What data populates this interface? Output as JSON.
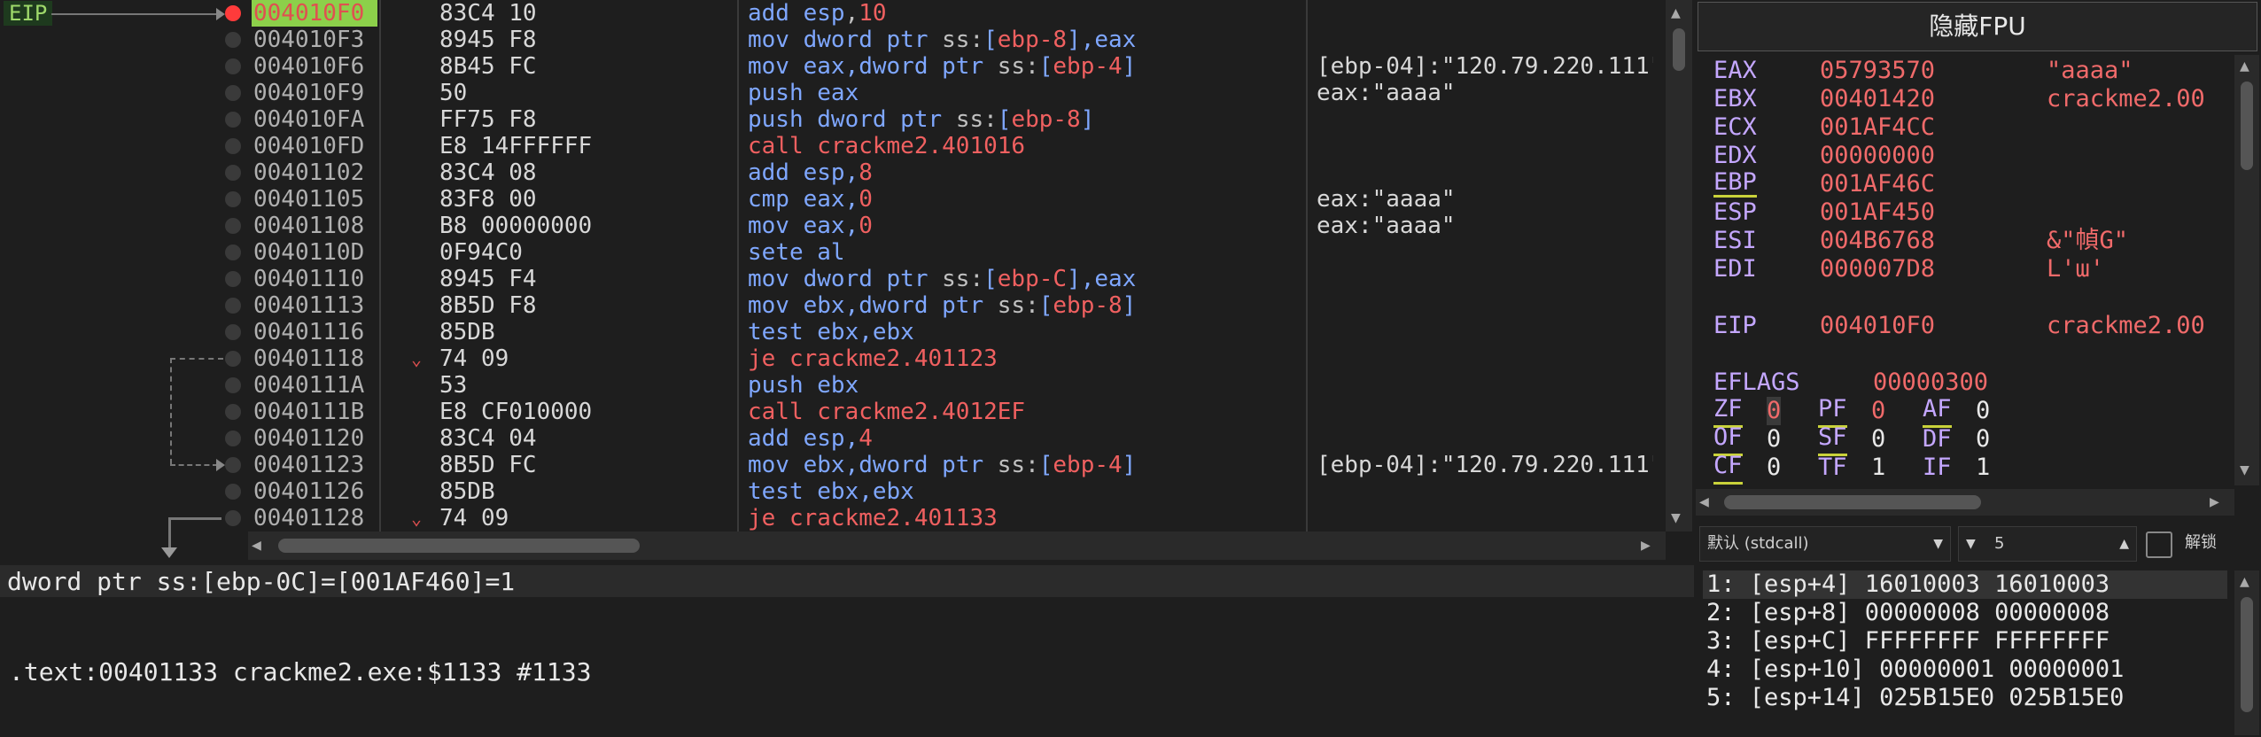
{
  "eip_label": "EIP",
  "disasm": [
    {
      "addr": "004010F0",
      "bytes": "83C4 10",
      "ins": [
        [
          "add ",
          "b"
        ],
        [
          "esp",
          "b"
        ],
        [
          ",",
          "d"
        ],
        [
          "10",
          "r"
        ]
      ],
      "cmt": "",
      "cur": true,
      "bp": true
    },
    {
      "addr": "004010F3",
      "bytes": "8945 F8",
      "ins": [
        [
          "mov dword ptr ",
          "b"
        ],
        [
          "ss:",
          "d"
        ],
        [
          "[",
          "b"
        ],
        [
          "ebp-8",
          "r"
        ],
        [
          "],eax",
          "b"
        ]
      ],
      "cmt": ""
    },
    {
      "addr": "004010F6",
      "bytes": "8B45 FC",
      "ins": [
        [
          "mov eax,dword ptr ",
          "b"
        ],
        [
          "ss:",
          "d"
        ],
        [
          "[",
          "b"
        ],
        [
          "ebp-4",
          "r"
        ],
        [
          "]",
          "b"
        ]
      ],
      "cmt": "[ebp-04]:\"120.79.220.111\""
    },
    {
      "addr": "004010F9",
      "bytes": "50",
      "ins": [
        [
          "push eax",
          "b"
        ]
      ],
      "cmt": "eax:\"aaaa\""
    },
    {
      "addr": "004010FA",
      "bytes": "FF75 F8",
      "ins": [
        [
          "push dword ptr ",
          "b"
        ],
        [
          "ss:",
          "d"
        ],
        [
          "[",
          "b"
        ],
        [
          "ebp-8",
          "r"
        ],
        [
          "]",
          "b"
        ]
      ],
      "cmt": ""
    },
    {
      "addr": "004010FD",
      "bytes": "E8 14FFFFFF",
      "ins": [
        [
          "call crackme2.401016",
          "r"
        ]
      ],
      "cmt": ""
    },
    {
      "addr": "00401102",
      "bytes": "83C4 08",
      "ins": [
        [
          "add esp,",
          "b"
        ],
        [
          "8",
          "r"
        ]
      ],
      "cmt": ""
    },
    {
      "addr": "00401105",
      "bytes": "83F8 00",
      "ins": [
        [
          "cmp eax,",
          "b"
        ],
        [
          "0",
          "r"
        ]
      ],
      "cmt": "eax:\"aaaa\""
    },
    {
      "addr": "00401108",
      "bytes": "B8 00000000",
      "ins": [
        [
          "mov eax,",
          "b"
        ],
        [
          "0",
          "r"
        ]
      ],
      "cmt": "eax:\"aaaa\""
    },
    {
      "addr": "0040110D",
      "bytes": "0F94C0",
      "ins": [
        [
          "sete al",
          "b"
        ]
      ],
      "cmt": ""
    },
    {
      "addr": "00401110",
      "bytes": "8945 F4",
      "ins": [
        [
          "mov dword ptr ",
          "b"
        ],
        [
          "ss:",
          "d"
        ],
        [
          "[",
          "b"
        ],
        [
          "ebp-C",
          "r"
        ],
        [
          "],eax",
          "b"
        ]
      ],
      "cmt": ""
    },
    {
      "addr": "00401113",
      "bytes": "8B5D F8",
      "ins": [
        [
          "mov ebx,dword ptr ",
          "b"
        ],
        [
          "ss:",
          "d"
        ],
        [
          "[",
          "b"
        ],
        [
          "ebp-8",
          "r"
        ],
        [
          "]",
          "b"
        ]
      ],
      "cmt": ""
    },
    {
      "addr": "00401116",
      "bytes": "85DB",
      "ins": [
        [
          "test ebx,ebx",
          "b"
        ]
      ],
      "cmt": ""
    },
    {
      "addr": "00401118",
      "bytes": "74 09",
      "ins": [
        [
          "je crackme2.401123",
          "r"
        ]
      ],
      "cmt": "",
      "jmp": true
    },
    {
      "addr": "0040111A",
      "bytes": "53",
      "ins": [
        [
          "push ebx",
          "b"
        ]
      ],
      "cmt": ""
    },
    {
      "addr": "0040111B",
      "bytes": "E8 CF010000",
      "ins": [
        [
          "call crackme2.4012EF",
          "r"
        ]
      ],
      "cmt": ""
    },
    {
      "addr": "00401120",
      "bytes": "83C4 04",
      "ins": [
        [
          "add esp,",
          "b"
        ],
        [
          "4",
          "r"
        ]
      ],
      "cmt": ""
    },
    {
      "addr": "00401123",
      "bytes": "8B5D FC",
      "ins": [
        [
          "mov ebx,dword ptr ",
          "b"
        ],
        [
          "ss:",
          "d"
        ],
        [
          "[",
          "b"
        ],
        [
          "ebp-4",
          "r"
        ],
        [
          "]",
          "b"
        ]
      ],
      "cmt": "[ebp-04]:\"120.79.220.111\""
    },
    {
      "addr": "00401126",
      "bytes": "85DB",
      "ins": [
        [
          "test ebx,ebx",
          "b"
        ]
      ],
      "cmt": ""
    },
    {
      "addr": "00401128",
      "bytes": "74 09",
      "ins": [
        [
          "je crackme2.401133",
          "r"
        ]
      ],
      "cmt": "",
      "jmp": true
    }
  ],
  "info": {
    "line1": "dword ptr ss:[ebp-0C]=[001AF460]=1",
    "line2": ".text:00401133 crackme2.exe:$1133 #1133"
  },
  "fpu_button": "隐藏FPU",
  "registers": [
    {
      "name": "EAX",
      "value": "05793570",
      "comment": "\"aaaa\""
    },
    {
      "name": "EBX",
      "value": "00401420",
      "comment": "crackme2.00"
    },
    {
      "name": "ECX",
      "value": "001AF4CC",
      "comment": ""
    },
    {
      "name": "EDX",
      "value": "00000000",
      "comment": ""
    },
    {
      "name": "EBP",
      "value": "001AF46C",
      "comment": "",
      "ul": true
    },
    {
      "name": "ESP",
      "value": "001AF450",
      "comment": ""
    },
    {
      "name": "ESI",
      "value": "004B6768",
      "comment": "&\"幀G\""
    },
    {
      "name": "EDI",
      "value": "000007D8",
      "comment": "L'ɯ'"
    }
  ],
  "eip": {
    "name": "EIP",
    "value": "004010F0",
    "comment": "crackme2.00"
  },
  "eflags": {
    "name": "EFLAGS",
    "value": "00000300"
  },
  "flags": [
    [
      {
        "n": "ZF",
        "v": "0",
        "ul": true,
        "hl": true
      },
      {
        "n": "PF",
        "v": "0",
        "ul": true,
        "red": true
      },
      {
        "n": "AF",
        "v": "0",
        "ul": true
      }
    ],
    [
      {
        "n": "OF",
        "v": "0",
        "ul": true
      },
      {
        "n": "SF",
        "v": "0",
        "ul": true
      },
      {
        "n": "DF",
        "v": "0"
      }
    ],
    [
      {
        "n": "CF",
        "v": "0",
        "ul": true
      },
      {
        "n": "TF",
        "v": "1"
      },
      {
        "n": "IF",
        "v": "1"
      }
    ]
  ],
  "callconv": {
    "value": "默认 (stdcall)",
    "count": "5",
    "unlock": "解锁"
  },
  "args": [
    "1: [esp+4] 16010003 16010003",
    "2: [esp+8] 00000008 00000008",
    "3: [esp+C] FFFFFFFF FFFFFFFF",
    "4: [esp+10] 00000001 00000001",
    "5: [esp+14] 025B15E0 025B15E0"
  ]
}
